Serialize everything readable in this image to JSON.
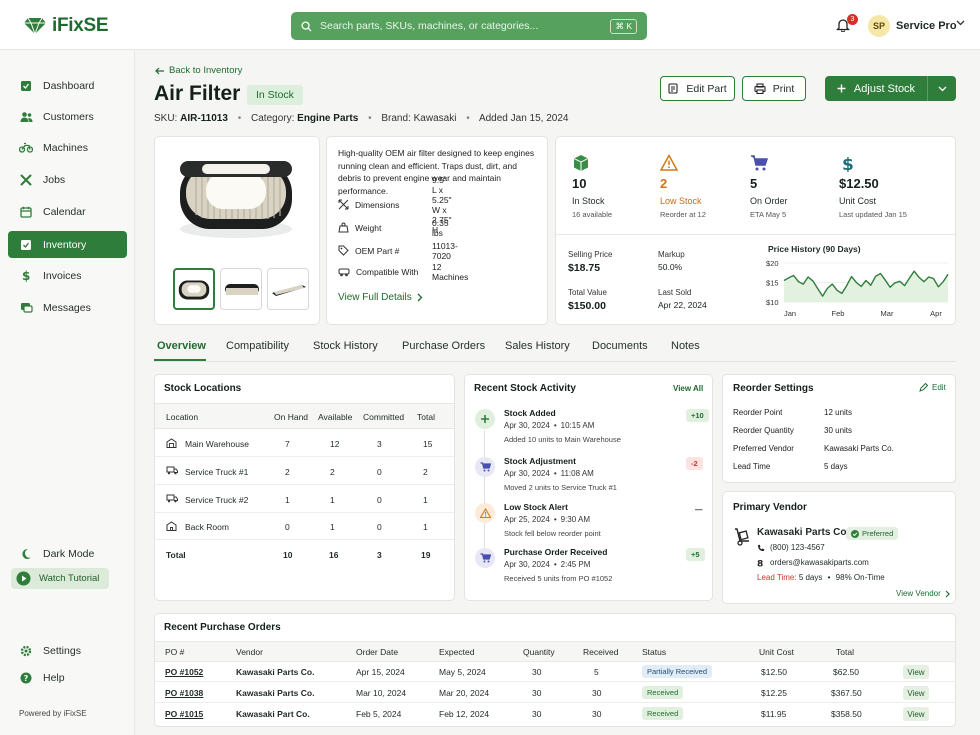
{
  "app": {
    "name": "iFixSE",
    "powered_by": "Powered by iFixSE"
  },
  "search": {
    "placeholder": "Search parts, SKUs, machines, or categories...",
    "shortcut": "⌘ K"
  },
  "user": {
    "initials": "SP",
    "name": "Service Pro",
    "notifications": "3"
  },
  "sidebar": {
    "items": [
      {
        "label": "Dashboard",
        "icon": "dashboard-icon"
      },
      {
        "label": "Customers",
        "icon": "users-icon"
      },
      {
        "label": "Machines",
        "icon": "bike-icon"
      },
      {
        "label": "Jobs",
        "icon": "tools-icon"
      },
      {
        "label": "Calendar",
        "icon": "calendar-icon"
      },
      {
        "label": "Inventory",
        "icon": "box-icon",
        "active": true
      },
      {
        "label": "Invoices",
        "icon": "invoice-icon"
      },
      {
        "label": "Messages",
        "icon": "chat-icon"
      }
    ],
    "dark_mode": "Dark Mode",
    "watch_tutorial": "Watch Tutorial",
    "settings": "Settings",
    "help": "Help"
  },
  "header": {
    "back": "Back to Inventory",
    "title": "Air Filter",
    "status": "In Stock",
    "sku_label": "SKU:",
    "sku": "AIR-11013",
    "category_label": "Category:",
    "category": "Engine Parts",
    "brand": "Brand: Kawasaki",
    "added": "Added Jan 15, 2024",
    "edit": "Edit Part",
    "print": "Print",
    "adjust": "Adjust Stock"
  },
  "product": {
    "description": "High-quality OEM air filter designed to keep engines running clean and efficient. Traps dust, dirt, and debris to prevent engine wear and maintain performance.",
    "specs": [
      {
        "label": "Dimensions",
        "value": "9.5\" L x 5.25\" W x 2.75\" H",
        "icon": "ruler-icon"
      },
      {
        "label": "Weight",
        "value": "0.35 lbs",
        "icon": "weight-icon"
      },
      {
        "label": "OEM Part #",
        "value": "11013-7020",
        "icon": "tag-icon"
      },
      {
        "label": "Compatible With",
        "value": "12 Machines",
        "icon": "machine-icon"
      }
    ],
    "view_details": "View Full Details"
  },
  "stats": [
    {
      "value": "10",
      "label": "In Stock",
      "sub": "16 available",
      "color": "#e6f1e3",
      "icon": "box-icon"
    },
    {
      "value": "2",
      "label": "Low Stock",
      "sub": "Reorder at 12",
      "color": "#fdf0e3",
      "icon": "warning-icon"
    },
    {
      "value": "5",
      "label": "On Order",
      "sub": "ETA May 5",
      "color": "#eeeef8",
      "icon": "cart-icon"
    },
    {
      "value": "$12.50",
      "label": "Unit Cost",
      "sub": "Last updated Jan 15",
      "color": "#e6f1f3",
      "icon": "dollar-icon"
    }
  ],
  "pricing": {
    "selling_price_label": "Selling Price",
    "selling_price": "$18.75",
    "markup_label": "Markup",
    "markup": "50.0%",
    "total_value_label": "Total Value",
    "total_value": "$150.00",
    "last_sold_label": "Last Sold",
    "last_sold": "Apr 22, 2024"
  },
  "price_history": {
    "title": "Price History (90 Days)",
    "y_ticks": [
      "$20",
      "$15",
      "$10"
    ],
    "x_ticks": [
      "Jan",
      "Feb",
      "Mar",
      "Apr"
    ]
  },
  "chart_data": {
    "type": "area",
    "title": "Price History (90 Days)",
    "xlabel": "",
    "ylabel": "",
    "ylim": [
      10,
      20
    ],
    "x_ticks": [
      "Jan",
      "Feb",
      "Mar",
      "Apr"
    ],
    "values": [
      15.5,
      16.2,
      16.8,
      15.2,
      14.6,
      16.4,
      15.4,
      13.4,
      11.5,
      13.5,
      14.6,
      13.0,
      12.2,
      14.2,
      16.5,
      15.0,
      14.0,
      15.5,
      14.3,
      16.6,
      17.3,
      15.6,
      13.8,
      14.9,
      15.3,
      14.2,
      16.1,
      17.9,
      16.3,
      15.2,
      16.4,
      16.0,
      13.9,
      15.2,
      17.1
    ]
  },
  "tabs": [
    "Overview",
    "Compatibility",
    "Stock History",
    "Purchase Orders",
    "Sales History",
    "Documents",
    "Notes"
  ],
  "stock_locations": {
    "title": "Stock Locations",
    "columns": [
      "Location",
      "On Hand",
      "Available",
      "Committed",
      "Total"
    ],
    "rows": [
      {
        "name": "Main Warehouse",
        "icon": "warehouse-icon",
        "on_hand": "7",
        "available": "12",
        "committed": "3",
        "total": "15"
      },
      {
        "name": "Service Truck #1",
        "icon": "truck-icon",
        "on_hand": "2",
        "available": "2",
        "committed": "0",
        "total": "2"
      },
      {
        "name": "Service Truck #2",
        "icon": "truck-icon",
        "on_hand": "1",
        "available": "1",
        "committed": "0",
        "total": "1"
      },
      {
        "name": "Back Room",
        "icon": "building-icon",
        "on_hand": "0",
        "available": "1",
        "committed": "0",
        "total": "1"
      }
    ],
    "total": {
      "label": "Total",
      "on_hand": "10",
      "available": "16",
      "committed": "3",
      "total": "19"
    }
  },
  "activity": {
    "title": "Recent Stock Activity",
    "view_all": "View All",
    "items": [
      {
        "title": "Stock Added",
        "date": "Apr 30, 2024",
        "time": "10:15 AM",
        "desc": "Added 10 units to Main Warehouse",
        "delta": "+10"
      },
      {
        "title": "Stock Adjustment",
        "date": "Apr 30, 2024",
        "time": "11:08 AM",
        "desc": "Moved 2 units to Service Truck #1",
        "delta": "-2"
      },
      {
        "title": "Low Stock Alert",
        "date": "Apr 25, 2024",
        "time": "9:30 AM",
        "desc": "Stock fell below reorder point",
        "delta": "—"
      },
      {
        "title": "Purchase Order Received",
        "date": "Apr 30, 2024",
        "time": "2:45 PM",
        "desc": "Received 5 units from PO #1052",
        "delta": "+5"
      }
    ]
  },
  "reorder": {
    "title": "Reorder Settings",
    "edit": "Edit",
    "rows": [
      {
        "label": "Reorder Point",
        "value": "12 units"
      },
      {
        "label": "Reorder Quantity",
        "value": "30 units"
      },
      {
        "label": "Preferred Vendor",
        "value": "Kawasaki Parts Co."
      },
      {
        "label": "Lead Time",
        "value": "5 days"
      }
    ]
  },
  "vendor": {
    "title": "Primary Vendor",
    "name": "Kawasaki Parts Co.",
    "badge": "Preferred",
    "phone": "(800) 123-4567",
    "email": "orders@kawasakiparts.com",
    "lead_label": "Lead Time:",
    "lead": "5 days",
    "ontime": "98% On-Time",
    "view": "View Vendor"
  },
  "purchase_orders": {
    "title": "Recent Purchase Orders",
    "columns": [
      "PO #",
      "Vendor",
      "Order Date",
      "Expected",
      "Quantity",
      "Received",
      "Status",
      "Unit Cost",
      "Total"
    ],
    "rows": [
      {
        "po": "PO #1052",
        "vendor": "Kawasaki Parts Co.",
        "order": "Apr 15, 2024",
        "expected": "May 5, 2024",
        "qty": "30",
        "received": "5",
        "status": "Partially Received",
        "unit": "$12.50",
        "total": "$62.50"
      },
      {
        "po": "PO #1038",
        "vendor": "Kawasaki Parts Co.",
        "order": "Mar 10, 2024",
        "expected": "Mar 20, 2024",
        "qty": "30",
        "received": "30",
        "status": "Received",
        "unit": "$12.25",
        "total": "$367.50"
      },
      {
        "po": "PO #1015",
        "vendor": "Kawasaki Part Co.",
        "order": "Feb 5, 2024",
        "expected": "Feb 12, 2024",
        "qty": "30",
        "received": "30",
        "status": "Received",
        "unit": "$11.95",
        "total": "$358.50"
      }
    ],
    "view_label": "View"
  }
}
